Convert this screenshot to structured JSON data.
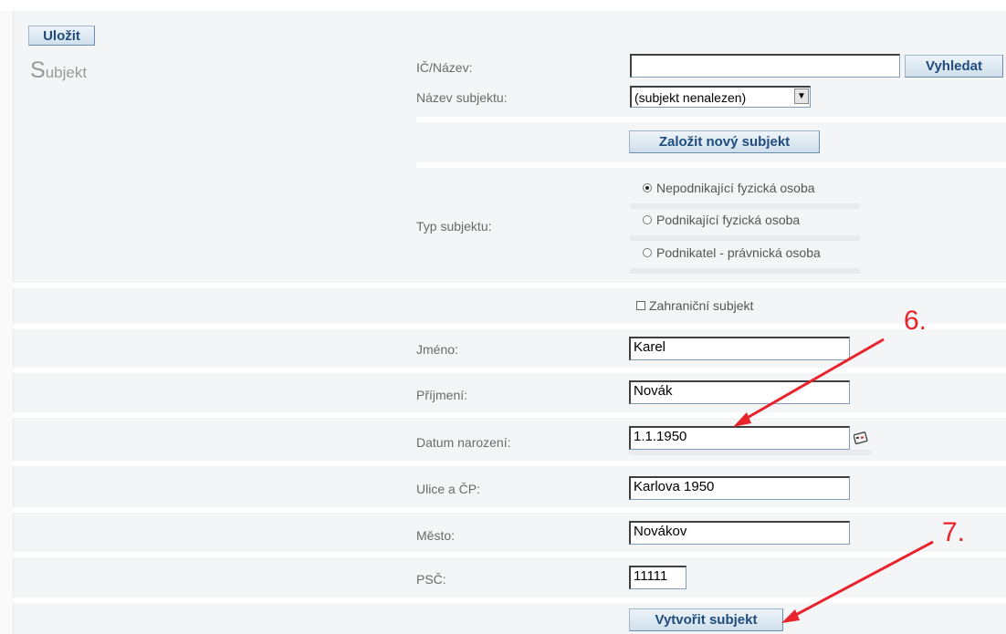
{
  "toolbar": {
    "save_label": "Uložit"
  },
  "section": {
    "title_initial": "S",
    "title_rest": "ubjekt"
  },
  "search": {
    "label": "IČ/Název:",
    "value": "",
    "button_label": "Vyhledat"
  },
  "subject_name": {
    "label": "Název subjektu:",
    "selected": "(subjekt nenalezen)"
  },
  "create_new_label": "Založit nový subjekt",
  "subject_type": {
    "label": "Typ subjektu:",
    "options": [
      {
        "label": "Nepodnikající fyzická osoba",
        "selected": true
      },
      {
        "label": "Podnikající fyzická osoba",
        "selected": false
      },
      {
        "label": "Podnikatel - právnická osoba",
        "selected": false
      }
    ]
  },
  "foreign": {
    "label": "Zahraniční subjekt",
    "checked": false
  },
  "fields": {
    "first_name": {
      "label": "Jméno:",
      "value": "Karel"
    },
    "last_name": {
      "label": "Příjmení:",
      "value": "Novák"
    },
    "birth_date": {
      "label": "Datum narození:",
      "value": "1.1.1950"
    },
    "street": {
      "label": "Ulice a ČP:",
      "value": "Karlova 1950"
    },
    "city": {
      "label": "Město:",
      "value": "Novákov"
    },
    "zip": {
      "label": "PSČ:",
      "value": "11111"
    }
  },
  "create_subject_label": "Vytvořit subjekt",
  "annotations": {
    "step6": "6.",
    "step7": "7."
  },
  "colors": {
    "accent_red": "#e8232c",
    "button_text": "#1f4c7d"
  },
  "icons": {
    "calendar": "calendar-icon",
    "dropdown": "chevron-down-icon"
  }
}
